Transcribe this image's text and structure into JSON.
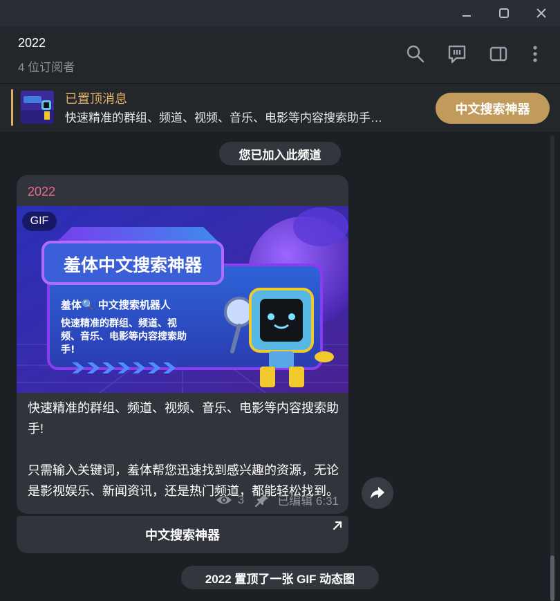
{
  "window": {
    "minimize_icon": "minimize-icon",
    "maximize_icon": "maximize-icon",
    "close_icon": "close-icon"
  },
  "header": {
    "title": "2022",
    "subtitle": "4 位订阅者",
    "icons": [
      "search-icon",
      "comments-icon",
      "sidebar-toggle-icon",
      "more-icon"
    ]
  },
  "pinned": {
    "label": "已置顶消息",
    "text": "快速精准的群组、频道、视频、音乐、电影等内容搜索助手…",
    "button": "中文搜索神器"
  },
  "service": {
    "joined": "您已加入此频道",
    "pinned_notice": "2022 置顶了一张 GIF 动态图"
  },
  "message": {
    "author": "2022",
    "media_badge": "GIF",
    "banner": {
      "headline": "羞体中文搜索神器",
      "subhead": "羞体🔍 中文搜索机器人",
      "lines": [
        "快速精准的群组、频道、视",
        "频、音乐、电影等内容搜索助",
        "手!"
      ]
    },
    "text": "快速精准的群组、频道、视频、音乐、电影等内容搜索助手!\n\n只需输入关键词，羞体帮您迅速找到感兴趣的资源，无论是影视娱乐、新闻资讯，还是热门频道，都能轻松找到。",
    "views": "3",
    "time": "已编辑 6:31",
    "inline_button": "中文搜索神器"
  },
  "colors": {
    "accent": "#e0b165",
    "author": "#e86a89",
    "bubble": "#31343a",
    "bg": "#1c1f24"
  }
}
